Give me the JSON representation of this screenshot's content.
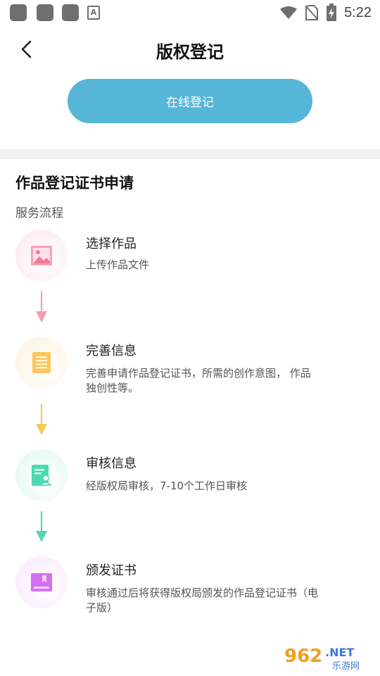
{
  "status_bar": {
    "time": "5:22",
    "notification_icons": [
      "app-icon",
      "app-icon",
      "app-icon",
      "font-a-icon"
    ],
    "font_icon_letter": "A",
    "right_icons": [
      "wifi-icon",
      "no-sim-icon",
      "battery-charging-icon"
    ]
  },
  "header": {
    "back_icon": "chevron-left-icon",
    "title": "版权登记"
  },
  "online_register": {
    "label": "在线登记",
    "color": "#55b6d8"
  },
  "section": {
    "title": "作品登记证书申请",
    "subtitle": "服务流程"
  },
  "steps": [
    {
      "icon": "image-icon",
      "title": "选择作品",
      "description": "上传作品文件",
      "color": "#f17b95",
      "bg_color": "#fdeef1"
    },
    {
      "icon": "document-lines-icon",
      "title": "完善信息",
      "description": "完善申请作品登记证书，所需的创作意图， 作品独创性等。",
      "color": "#fbc65c",
      "bg_color": "#fef6e7"
    },
    {
      "icon": "reviewer-document-icon",
      "title": "审核信息",
      "description": "经版权局审核，7-10个工作日审核",
      "color": "#4fd9b2",
      "bg_color": "#e9faf4"
    },
    {
      "icon": "certificate-tray-icon",
      "title": "颁发证书",
      "description": "审核通过后将获得版权局颁发的作品登记证书（电子版）",
      "color": "#d46ff0",
      "bg_color": "#faeefd"
    }
  ],
  "watermark": {
    "number": "962",
    "suffix": ".NET",
    "caption": "乐游网"
  }
}
